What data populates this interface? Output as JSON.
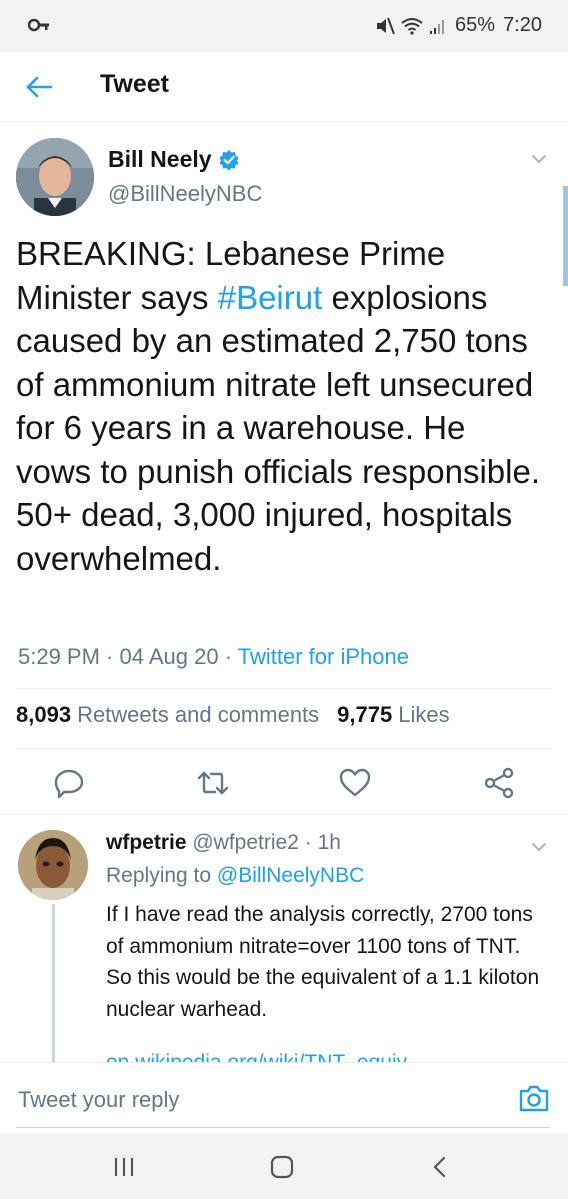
{
  "status_bar": {
    "battery": "65%",
    "time": "7:20"
  },
  "header": {
    "title": "Tweet"
  },
  "tweet": {
    "author_name": "Bill Neely",
    "author_handle": "@BillNeelyNBC",
    "text_part1": "BREAKING: Lebanese Prime Minister says ",
    "hashtag": "#Beirut",
    "text_part2": " explosions caused by an estimated 2,750 tons of ammonium nitrate left unsecured for 6 years in a warehouse. He vows to punish officials responsible. 50+ dead, 3,000 injured, hospitals overwhelmed.",
    "time": "5:29 PM",
    "date": "04 Aug 20",
    "source": "Twitter for iPhone",
    "retweets_count": "8,093",
    "retweets_label": "Retweets and comments",
    "likes_count": "9,775",
    "likes_label": "Likes"
  },
  "reply": {
    "author_name": "wfpetrie",
    "author_handle": "@wfpetrie2",
    "age": "1h",
    "replying_prefix": "Replying to",
    "replying_to": "@BillNeelyNBC",
    "text": "If I have read the analysis correctly, 2700 tons of ammonium nitrate=over 1100 tons of TNT.  So this would be the equivalent of a 1.1 kiloton nuclear warhead.",
    "link_partial": "en.wikipedia.org/wiki/TNT_equiv..."
  },
  "compose": {
    "placeholder": "Tweet your reply"
  },
  "colors": {
    "accent": "#1da1f2",
    "text": "#14171a",
    "secondary": "#657786",
    "verified": "#1da1f2"
  }
}
